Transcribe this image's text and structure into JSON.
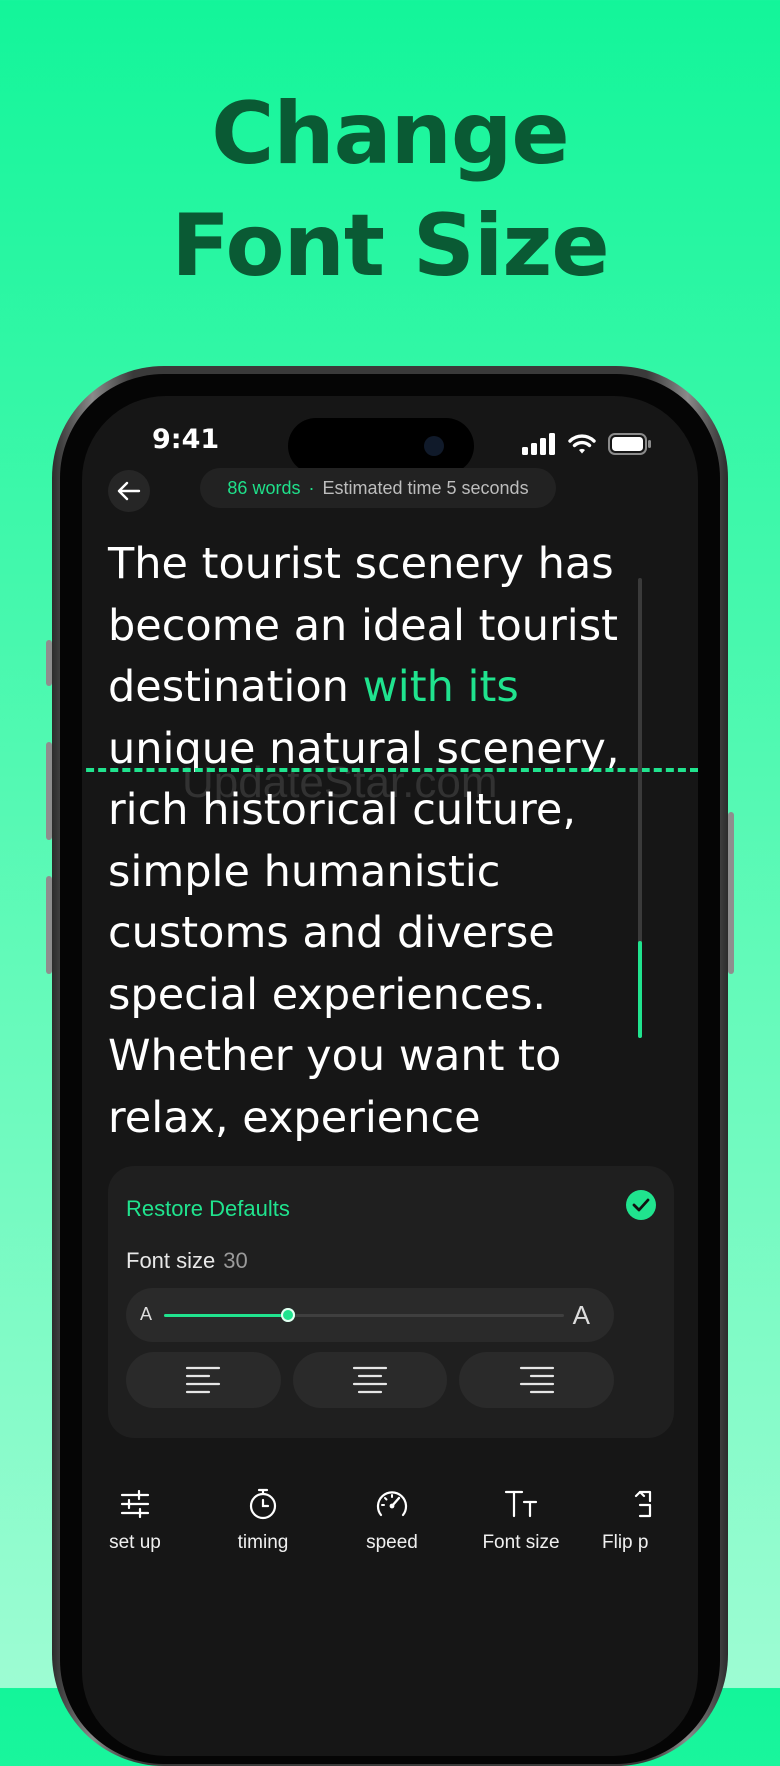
{
  "headline": {
    "line1": "Change",
    "line2": "Font Size"
  },
  "status_bar": {
    "time": "9:41"
  },
  "header": {
    "word_count": "86 words",
    "separator": "·",
    "estimated_time": "Estimated time 5 seconds"
  },
  "script": {
    "before_highlight": "The tourist scenery has become an ideal tourist destination ",
    "highlight": "with its",
    "after_highlight": " unique natural scenery, rich historical culture, simple humanistic customs and diverse special experiences. Whether you want to relax, experience"
  },
  "watermark": "UpdateStar.com",
  "panel": {
    "restore_label": "Restore Defaults",
    "font_size_label": "Font size",
    "font_size_value": "30",
    "small_a": "A",
    "large_a": "A",
    "slider_fraction": 0.31
  },
  "tabs": [
    {
      "label": "set up",
      "icon": "sliders-icon"
    },
    {
      "label": "timing",
      "icon": "stopwatch-icon"
    },
    {
      "label": "speed",
      "icon": "speedometer-icon"
    },
    {
      "label": "Font size",
      "icon": "font-size-icon"
    },
    {
      "label": "Flip p",
      "icon": "flip-icon"
    }
  ],
  "colors": {
    "accent": "#20e38e",
    "headline": "#0a5a34",
    "screen_bg": "#161616"
  }
}
